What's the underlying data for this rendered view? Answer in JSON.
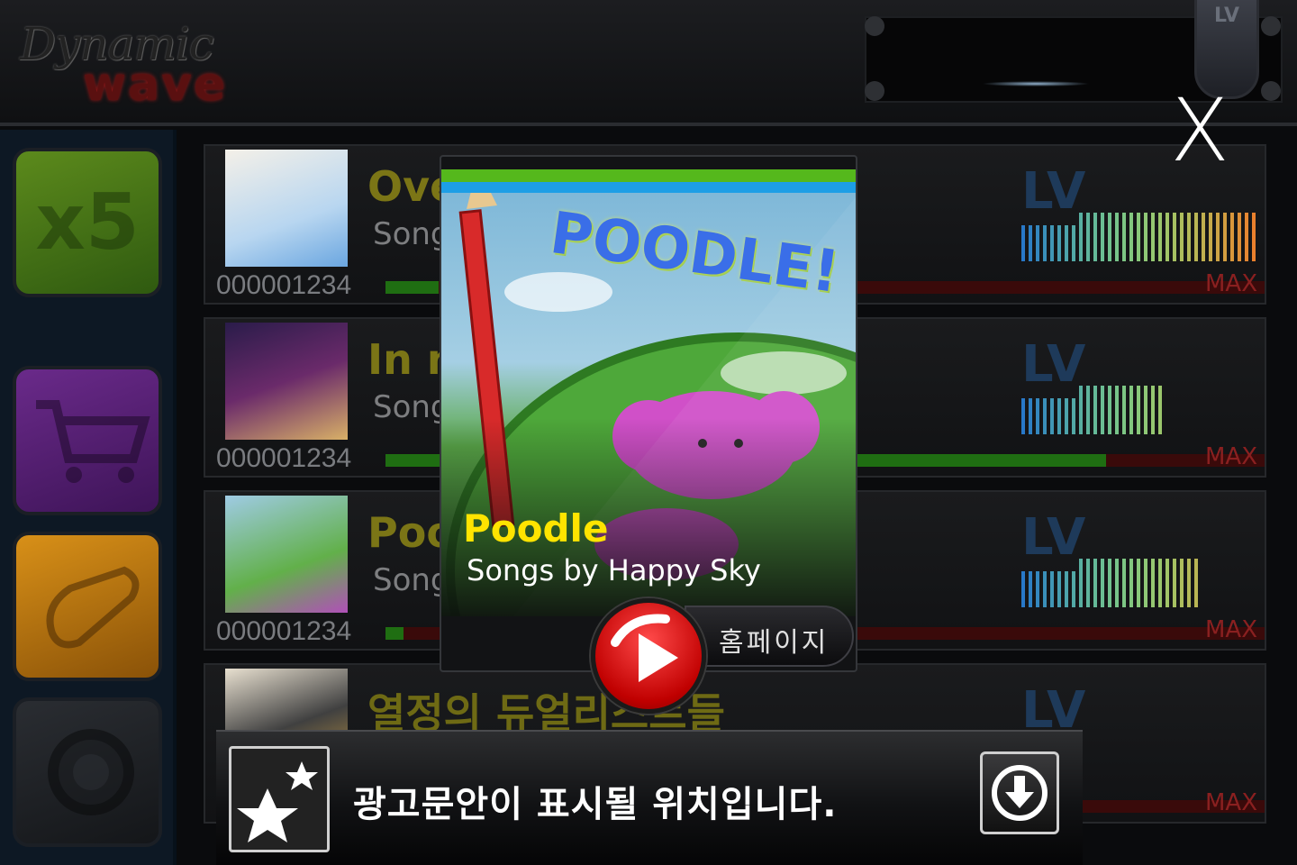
{
  "header": {
    "logo_line1": "Dynamic",
    "logo_line2": "wave",
    "lv_tab": "LV"
  },
  "sidebar": {
    "multiplier": "x5",
    "buttons": [
      "multiplier-icon",
      "cart-icon",
      "scroll-icon",
      "gear-icon"
    ]
  },
  "songs": [
    {
      "title": "Ove",
      "subtitle": "Song",
      "score": "000001234",
      "max": "MAX",
      "lv": "LV"
    },
    {
      "title": "In m",
      "subtitle": "Song",
      "score": "000001234",
      "max": "MAX",
      "lv": "LV"
    },
    {
      "title": "Poo",
      "subtitle": "Song",
      "score": "000001234",
      "max": "MAX",
      "lv": "LV"
    },
    {
      "title": "열정의 듀얼리스트들",
      "subtitle": "",
      "score": "",
      "max": "MAX",
      "lv": "LV"
    }
  ],
  "popup": {
    "art_text": "POODLE!",
    "title": "Poodle",
    "artist": "Songs by Happy Sky",
    "homepage_label": "홈페이지"
  },
  "close_label": "X",
  "ad": {
    "text": "광고문안이 표시될 위치입니다."
  },
  "colors": {
    "popup_title": "#ffe400",
    "stripe_green": "#55b81c",
    "stripe_blue": "#1d9ee6",
    "play_red": "#d40000"
  }
}
